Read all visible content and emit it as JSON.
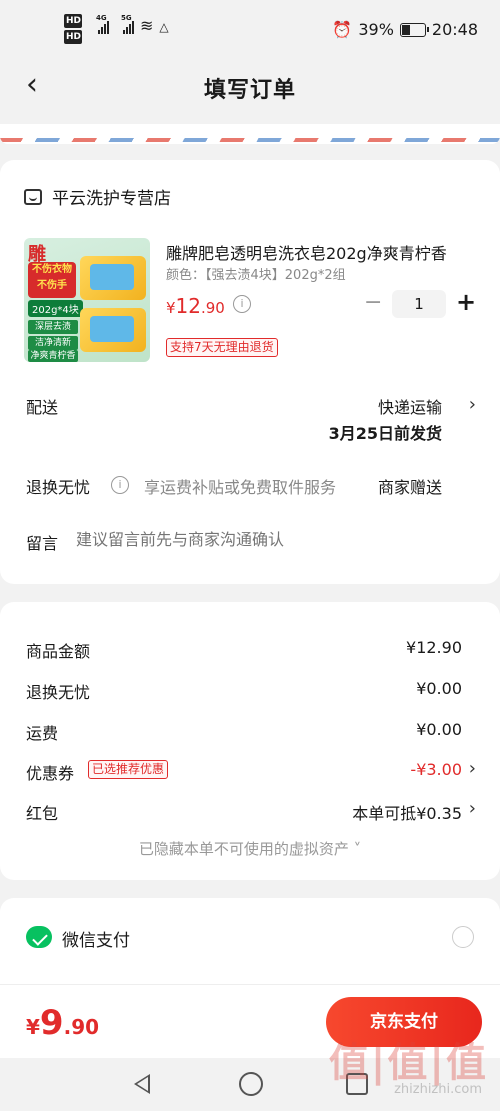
{
  "status_bar": {
    "battery": "39%",
    "time": "20:48",
    "hd1": "HD",
    "hd2": "HD",
    "net1": "4G",
    "net2": "5G"
  },
  "header": {
    "title": "填写订单"
  },
  "shop": {
    "name": "平云洗护专营店"
  },
  "product": {
    "name": "雕牌肥皂透明皂洗衣皂202g净爽青柠香",
    "spec": "颜色：【强去渍4块】202g*2组",
    "price_currency": "¥",
    "price_int": "12",
    "price_dec": ".90",
    "quantity": "1",
    "return_badge": "支持7天无理由退货",
    "image_text": {
      "logo": "雕",
      "slogan_1": "不伤衣物",
      "slogan_2": "不伤手",
      "spec": "202g*4块",
      "bar_1": "深层去渍",
      "bar_2": "洁净清新",
      "bar_3": "净爽青柠香"
    }
  },
  "delivery": {
    "label": "配送",
    "method": "快递运输",
    "date": "3月25日前发货"
  },
  "worry_free": {
    "label": "退换无忧",
    "desc": "享运费补贴或免费取件服务",
    "value": "商家赠送"
  },
  "message": {
    "label": "留言",
    "placeholder": "建议留言前先与商家沟通确认"
  },
  "summary": {
    "goods_label": "商品金额",
    "goods_value": "¥12.90",
    "worry_label": "退换无忧",
    "worry_value": "¥0.00",
    "shipping_label": "运费",
    "shipping_value": "¥0.00",
    "coupon_label": "优惠券",
    "coupon_badge": "已选推荐优惠",
    "coupon_value": "-¥3.00",
    "redpacket_label": "红包",
    "redpacket_value": "本单可抵¥0.35",
    "hidden_note": "已隐藏本单不可使用的虚拟资产 ˅"
  },
  "payment": {
    "wechat_label": "微信支付"
  },
  "footer": {
    "total_currency": "¥",
    "total_int": "9",
    "total_dec": ".90",
    "pay_button": "京东支付"
  },
  "watermark": {
    "text": "值|值|值",
    "sub": "zhizhizhi.com"
  },
  "colors": {
    "accent_red": "#e12b2b",
    "wechat_green": "#07c160",
    "background": "#f2f2f2"
  }
}
